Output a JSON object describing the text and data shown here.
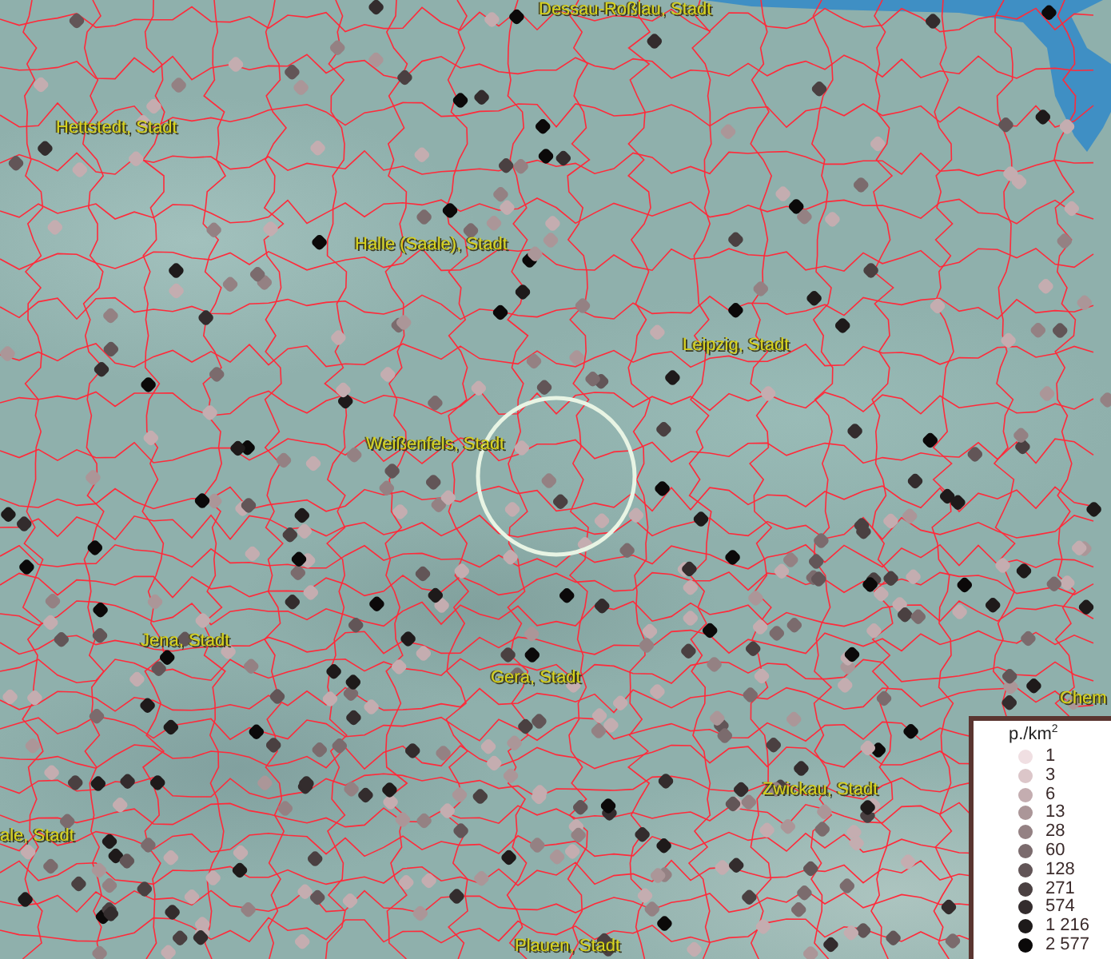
{
  "map": {
    "place_labels": [
      {
        "text": "Dessau-Roßlau, Stadt"
      },
      {
        "text": "Hettstedt, Stadt"
      },
      {
        "text": "Halle (Saale), Stadt"
      },
      {
        "text": "Leipzig, Stadt"
      },
      {
        "text": "Weißenfels, Stadt"
      },
      {
        "text": "Jena, Stadt"
      },
      {
        "text": "Gera, Stadt"
      },
      {
        "text": "ale, Stadt"
      },
      {
        "text": "Zwickau, Stadt"
      },
      {
        "text": "Plauen, Stadt"
      },
      {
        "text": "Chem"
      }
    ]
  },
  "legend": {
    "title": "p./km$^{2}$",
    "items": [
      {
        "label": "1",
        "color": "#f0dfe2"
      },
      {
        "label": "3",
        "color": "#dcc6c9"
      },
      {
        "label": "6",
        "color": "#c4adb0"
      },
      {
        "label": "13",
        "color": "#ab9698"
      },
      {
        "label": "28",
        "color": "#948183"
      },
      {
        "label": "60",
        "color": "#7b6b6d"
      },
      {
        "label": "128",
        "color": "#625557"
      },
      {
        "label": "271",
        "color": "#4a4041"
      },
      {
        "label": "574",
        "color": "#332c2d"
      },
      {
        "label": "1 216",
        "color": "#1e1a1a"
      },
      {
        "label": "2 577",
        "color": "#0b0909"
      }
    ]
  }
}
